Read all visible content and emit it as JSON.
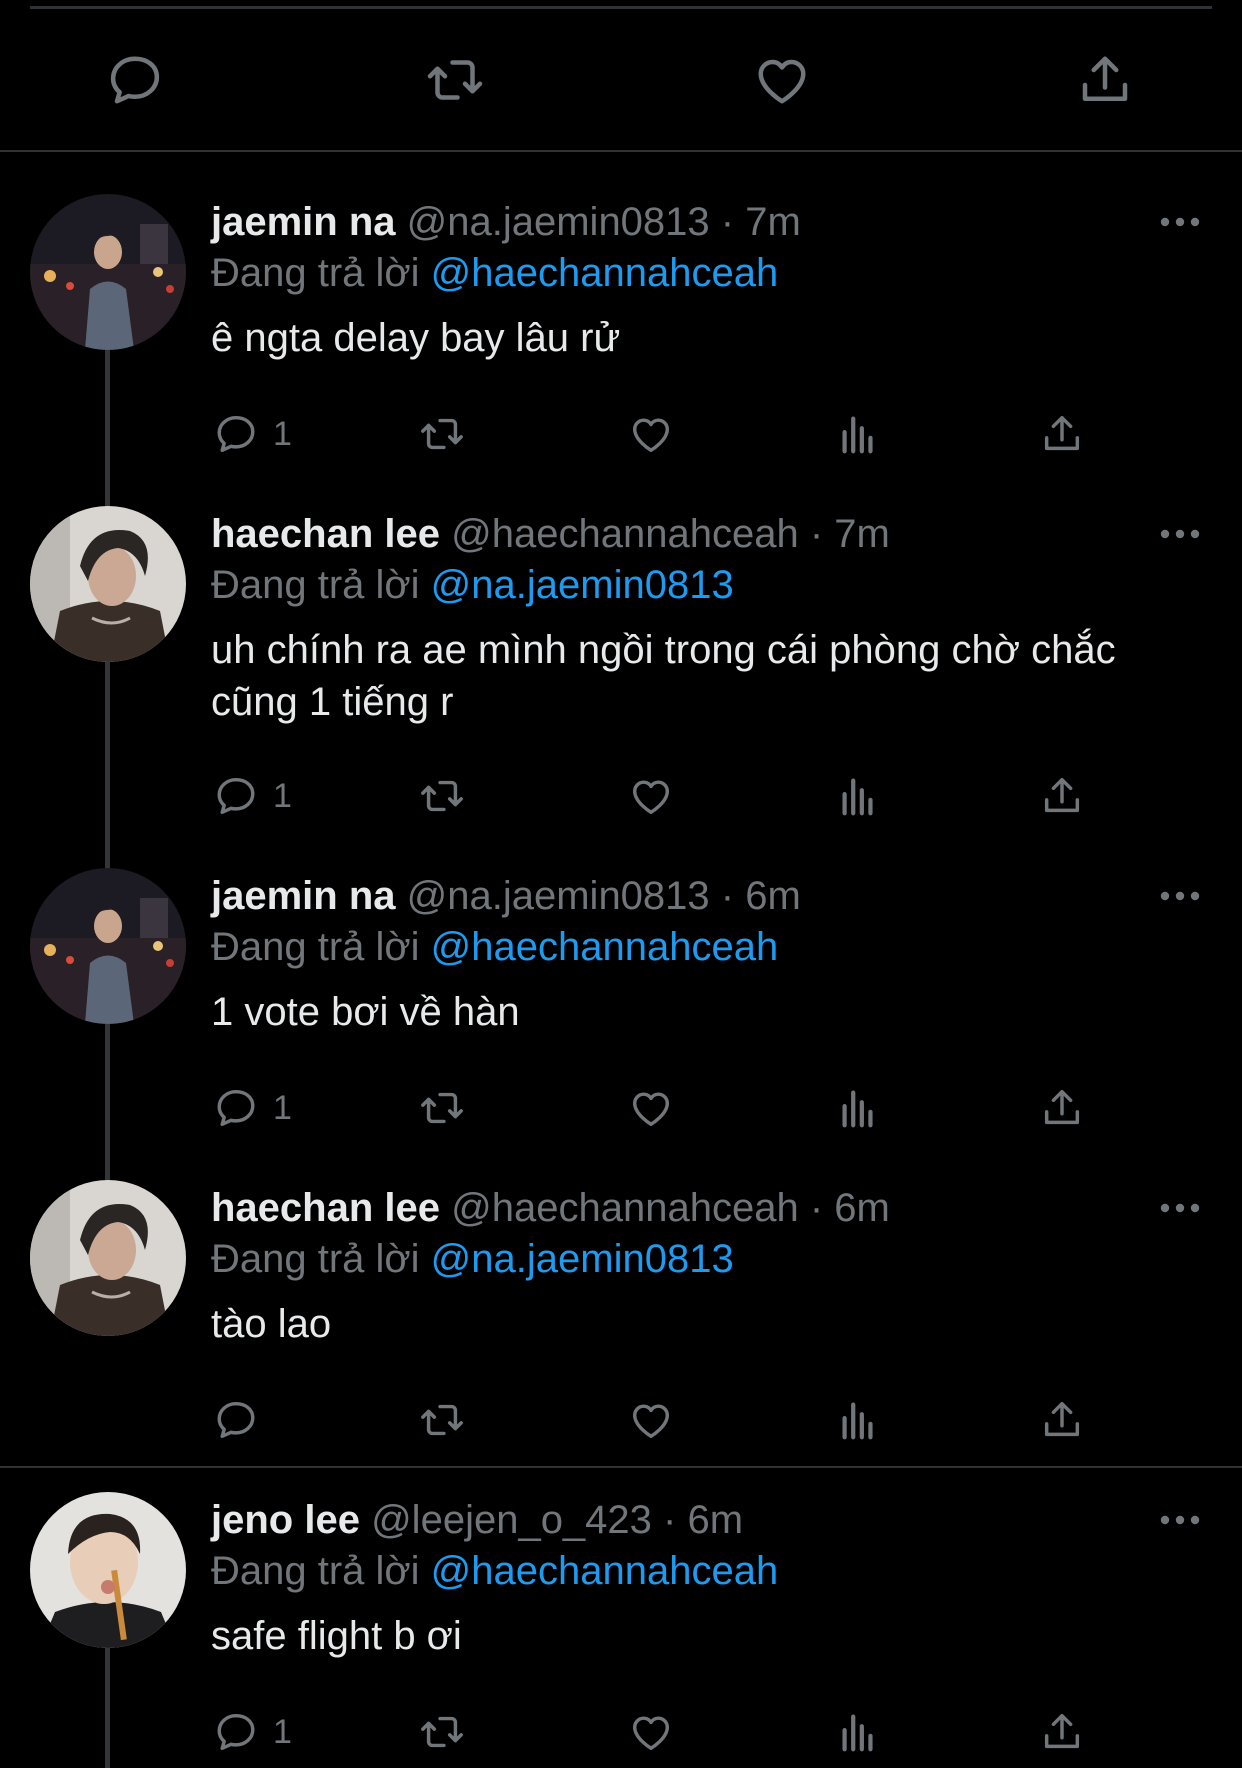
{
  "top_actions": [
    "reply-icon",
    "retweet-icon",
    "like-icon",
    "share-icon"
  ],
  "colors": {
    "background": "#000000",
    "text": "#e7e9ea",
    "muted": "#71767b",
    "accent": "#1d9bf0",
    "divider": "#2f3336"
  },
  "replies": [
    {
      "name": "jaemin na",
      "handle": "@na.jaemin0813",
      "dot": "·",
      "time": "7m",
      "replying_prefix": "Đang trả lời",
      "replying_to": "@haechannahceah",
      "text": "ê ngta delay bay lâu rử",
      "reply_count": "1"
    },
    {
      "name": "haechan lee",
      "handle": "@haechannahceah",
      "dot": "·",
      "time": "7m",
      "replying_prefix": "Đang trả lời",
      "replying_to": "@na.jaemin0813",
      "text": "uh chính ra ae mình ngồi trong cái phòng chờ chắc cũng 1 tiếng r",
      "reply_count": "1"
    },
    {
      "name": "jaemin na",
      "handle": "@na.jaemin0813",
      "dot": "·",
      "time": "6m",
      "replying_prefix": "Đang trả lời",
      "replying_to": "@haechannahceah",
      "text": "1 vote bơi về hàn",
      "reply_count": "1"
    },
    {
      "name": "haechan lee",
      "handle": "@haechannahceah",
      "dot": "·",
      "time": "6m",
      "replying_prefix": "Đang trả lời",
      "replying_to": "@na.jaemin0813",
      "text": "tào lao",
      "reply_count": ""
    },
    {
      "name": "jeno lee",
      "handle": "@leejen_o_423",
      "dot": "·",
      "time": "6m",
      "replying_prefix": "Đang trả lời",
      "replying_to": "@haechannahceah",
      "text": "safe flight b ơi",
      "reply_count": "1"
    }
  ]
}
